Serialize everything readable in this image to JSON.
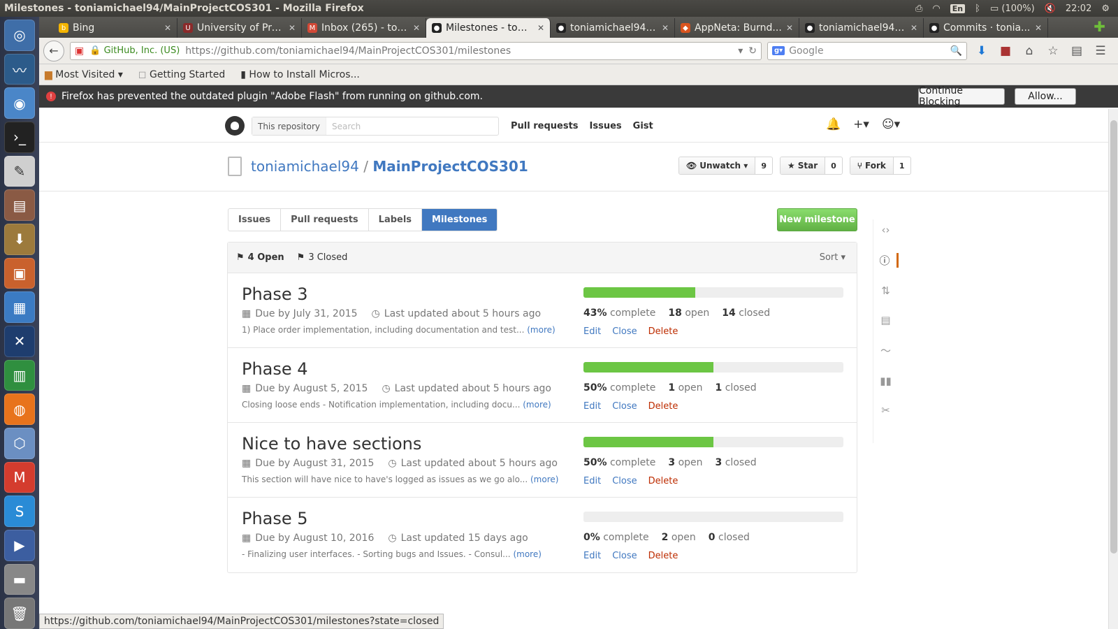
{
  "window": {
    "title": "Milestones - toniamichael94/MainProjectCOS301 - Mozilla Firefox"
  },
  "system": {
    "keyboard": "En",
    "battery": "(100%)",
    "time": "22:02"
  },
  "tabs": [
    {
      "label": "Bing",
      "color": "#f4b400"
    },
    {
      "label": "University of Pre...",
      "color": "#8b2a2a"
    },
    {
      "label": "Inbox (265) - ton...",
      "color": "#d14836"
    },
    {
      "label": "Milestones - toni...",
      "color": "#222222",
      "active": true
    },
    {
      "label": "toniamichael94/...",
      "color": "#222222"
    },
    {
      "label": "AppNeta: Burnd...",
      "color": "#d9541e"
    },
    {
      "label": "toniamichael94/...",
      "color": "#222222"
    },
    {
      "label": "Commits · tonia...",
      "color": "#222222"
    }
  ],
  "navbar": {
    "identity": "GitHub, Inc. (US)",
    "url": "https://github.com/toniamichael94/MainProjectCOS301/milestones",
    "search_placeholder": "Google"
  },
  "bookmarks": [
    "Most Visited ▾",
    "Getting Started",
    "How to Install Micros..."
  ],
  "plugin_bar": {
    "message": "Firefox has prevented the outdated plugin \"Adobe Flash\" from running on github.com.",
    "continue_label": "Continue Blocking",
    "allow_label": "Allow..."
  },
  "github": {
    "search_scope": "This repository",
    "search_placeholder": "Search",
    "nav": [
      "Pull requests",
      "Issues",
      "Gist"
    ],
    "repo_owner": "toniamichael94",
    "repo_name": "MainProjectCOS301",
    "watch_label": "Unwatch ▾",
    "watch_count": "9",
    "star_label": "Star",
    "star_count": "0",
    "fork_label": "Fork",
    "fork_count": "1",
    "subnav": [
      "Issues",
      "Pull requests",
      "Labels",
      "Milestones"
    ],
    "new_milestone": "New milestone",
    "open_label": "4 Open",
    "closed_label": "3 Closed",
    "sort_label": "Sort ▾"
  },
  "milestones": [
    {
      "title": "Phase 3",
      "due": "Due by July 31, 2015",
      "updated": "Last updated about 5 hours ago",
      "desc": "1) Place order implementation, including documentation and test...",
      "pct": 43,
      "pct_label": "43%",
      "open": "18",
      "closed": "14"
    },
    {
      "title": "Phase 4",
      "due": "Due by August 5, 2015",
      "updated": "Last updated about 5 hours ago",
      "desc": "Closing loose ends - Notification implementation, including docu...",
      "pct": 50,
      "pct_label": "50%",
      "open": "1",
      "closed": "1"
    },
    {
      "title": "Nice to have sections",
      "due": "Due by August 31, 2015",
      "updated": "Last updated about 5 hours ago",
      "desc": "This section will have nice to have's logged as issues as we go alo...",
      "pct": 50,
      "pct_label": "50%",
      "open": "3",
      "closed": "3"
    },
    {
      "title": "Phase 5",
      "due": "Due by August 10, 2016",
      "updated": "Last updated 15 days ago",
      "desc": "- Finalizing user interfaces. - Sorting bugs and Issues. - Consul...",
      "pct": 0,
      "pct_label": "0%",
      "open": "2",
      "closed": "0"
    }
  ],
  "labels": {
    "complete": "complete",
    "open": "open",
    "closed": "closed",
    "more": "(more)",
    "edit": "Edit",
    "close": "Close",
    "delete": "Delete"
  },
  "status_url": "https://github.com/toniamichael94/MainProjectCOS301/milestones?state=closed"
}
